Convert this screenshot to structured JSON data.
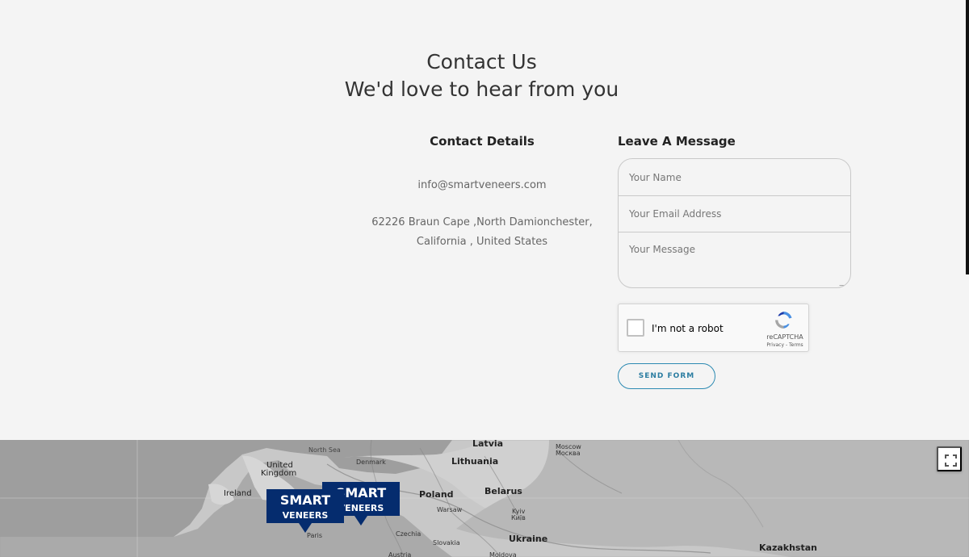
{
  "contact": {
    "title": "Contact Us",
    "subtitle": "We'd love to hear from you",
    "details_title": "Contact Details",
    "message_title": "Leave A Message",
    "email": "info@smartveneers.com",
    "address_line1": "62226 Braun Cape ,North Damionchester,",
    "address_line2": "California , United States"
  },
  "form": {
    "name_placeholder": "Your Name",
    "email_placeholder": "Your Email Address",
    "message_placeholder": "Your Message",
    "captcha_label": "I'm not a robot",
    "captcha_brand": "reCAPTCHA",
    "captcha_links": "Privacy - Terms",
    "send_label": "SEND FORM"
  },
  "map": {
    "labels": [
      "North Sea",
      "Latvia",
      "Moscow",
      "Москва",
      "United",
      "Kingdom",
      "Denmark",
      "Lithuania",
      "Ireland",
      "Poland",
      "Belarus",
      "Warsaw",
      "Kyiv",
      "Київ",
      "Paris",
      "Czechia",
      "Ukraine",
      "Slovakia",
      "Austria",
      "Moldova",
      "Kazakhstan"
    ],
    "marker_1": {
      "line1": "SMART",
      "line2": "VENEERS"
    },
    "marker_2": {
      "line1": "SMART",
      "line2": "VENEERS"
    },
    "fullscreen_icon": "fullscreen-icon"
  },
  "colors": {
    "background": "#f4f4f4",
    "accent": "#2c8ab2",
    "marker": "#052c6e"
  }
}
